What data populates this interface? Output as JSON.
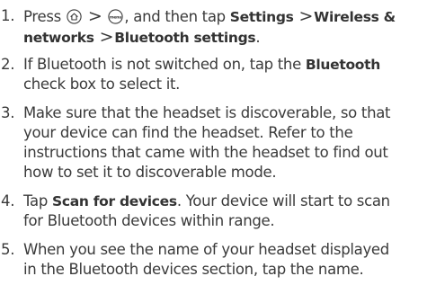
{
  "steps": [
    {
      "number": "1.",
      "line1_a": "Press",
      "home_icon": "home-key-icon",
      "separator": ">",
      "menu_icon": "menu-key-icon",
      "menu_icon_text": "menu",
      "line1_b": ", and then tap",
      "settings": "Settings",
      "wireless": "Wireless &",
      "networks": "networks",
      "bluetooth_settings": "Bluetooth settings",
      "period": "."
    },
    {
      "number": "2.",
      "line1_a": "If Bluetooth is not switched on, tap the",
      "bluetooth": "Bluetooth",
      "line2": "check box to select it."
    },
    {
      "number": "3.",
      "lines": [
        "Make sure that the headset is discoverable, so that",
        "your device can find the headset. Refer to the",
        "instructions that came with the headset to find out",
        "how to set it to discoverable mode."
      ]
    },
    {
      "number": "4.",
      "tap": "Tap",
      "scan": "Scan for devices",
      "line1_rest": ". Your device will start to scan",
      "line2": "for Bluetooth devices within range."
    },
    {
      "number": "5.",
      "lines": [
        "When you see the name of your headset displayed",
        "in the Bluetooth devices section, tap the name."
      ]
    }
  ]
}
